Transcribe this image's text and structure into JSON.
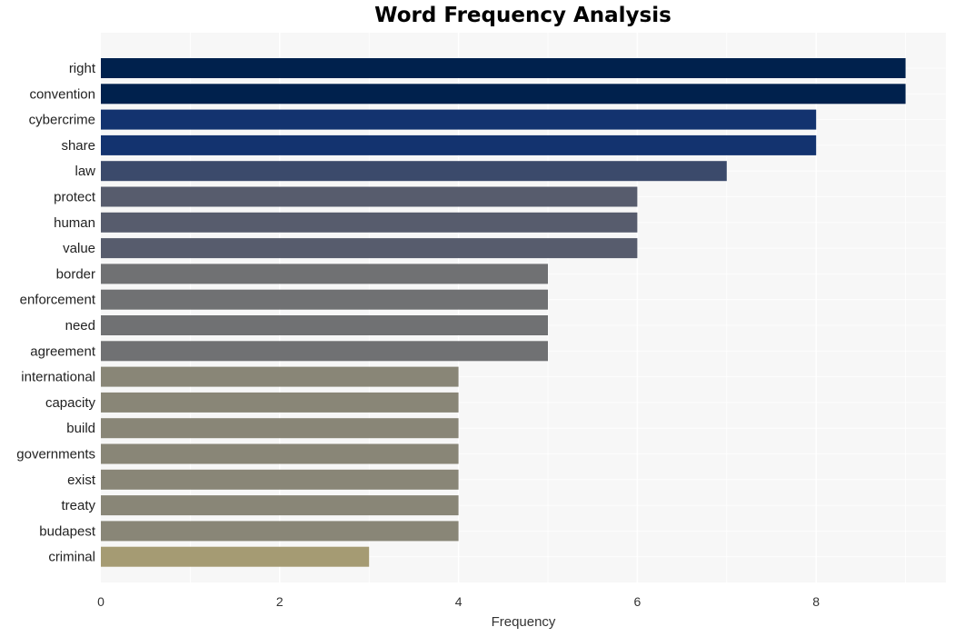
{
  "chart_data": {
    "type": "bar",
    "orientation": "horizontal",
    "title": "Word Frequency Analysis",
    "xlabel": "Frequency",
    "ylabel": "",
    "xlim": [
      0,
      9.45
    ],
    "xticks": [
      0,
      2,
      4,
      6,
      8
    ],
    "grid": true,
    "legend": "none",
    "categories": [
      "right",
      "convention",
      "cybercrime",
      "share",
      "law",
      "protect",
      "human",
      "value",
      "border",
      "enforcement",
      "need",
      "agreement",
      "international",
      "capacity",
      "build",
      "governments",
      "exist",
      "treaty",
      "budapest",
      "criminal"
    ],
    "values": [
      9,
      9,
      8,
      8,
      7,
      6,
      6,
      6,
      5,
      5,
      5,
      5,
      4,
      4,
      4,
      4,
      4,
      4,
      4,
      3
    ],
    "colors": {
      "9": "#00214d",
      "8": "#13336f",
      "7": "#3b4a6b",
      "6": "#575c6d",
      "5": "#707173",
      "4": "#898677",
      "3": "#a59b73"
    },
    "background": "#f7f7f7",
    "gridline_color": "#ffffff"
  }
}
